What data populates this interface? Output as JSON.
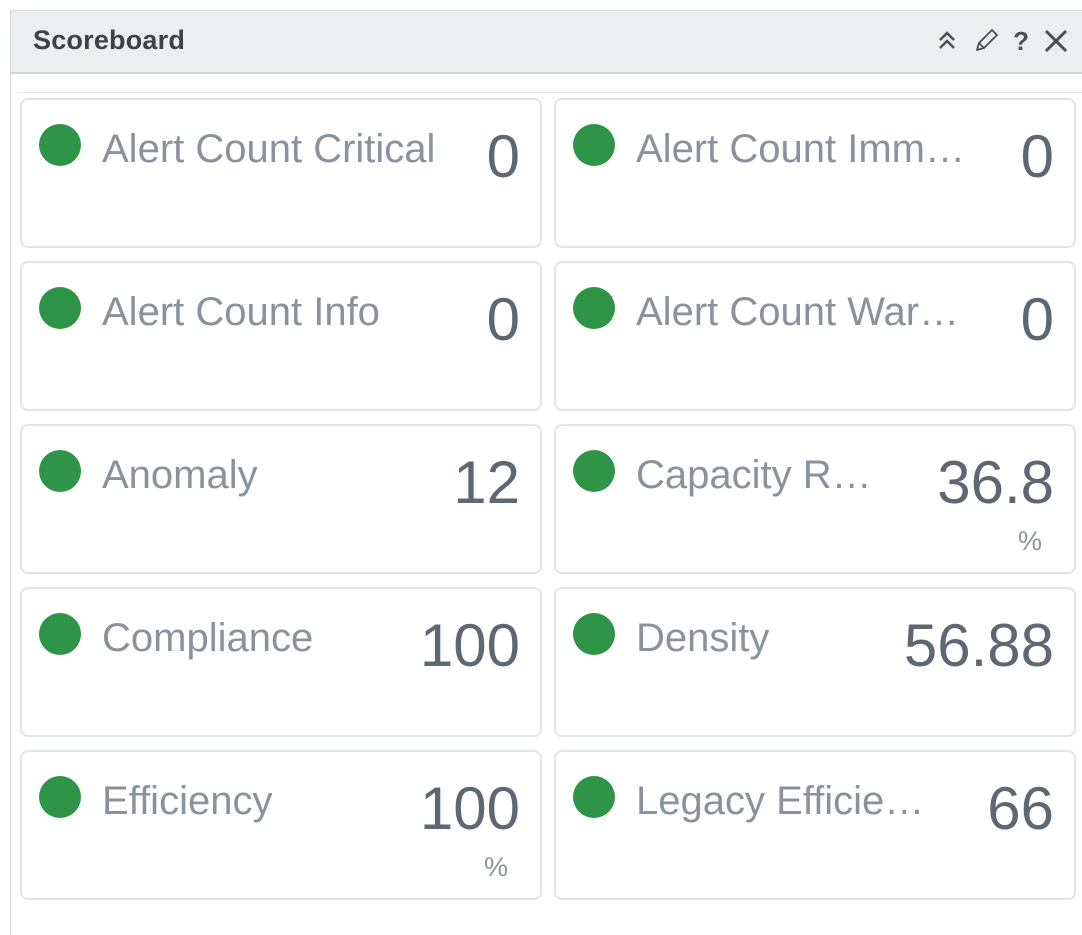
{
  "widget": {
    "title": "Scoreboard",
    "icons": [
      "collapse-icon",
      "edit-icon",
      "help-icon",
      "close-icon"
    ],
    "help_glyph": "?",
    "status_color": "#2e9447"
  },
  "tiles": [
    {
      "label": "Alert Count Critical",
      "value": "0",
      "unit": "",
      "status": "green"
    },
    {
      "label": "Alert Count Imm…",
      "value": "0",
      "unit": "",
      "status": "green"
    },
    {
      "label": "Alert Count Info",
      "value": "0",
      "unit": "",
      "status": "green"
    },
    {
      "label": "Alert Count War…",
      "value": "0",
      "unit": "",
      "status": "green"
    },
    {
      "label": "Anomaly",
      "value": "12",
      "unit": "",
      "status": "green"
    },
    {
      "label": "Capacity R…",
      "value": "36.8",
      "unit": "%",
      "status": "green"
    },
    {
      "label": "Compliance",
      "value": "100",
      "unit": "",
      "status": "green"
    },
    {
      "label": "Density",
      "value": "56.88",
      "unit": "",
      "status": "green"
    },
    {
      "label": "Efficiency",
      "value": "100",
      "unit": "%",
      "status": "green"
    },
    {
      "label": "Legacy Efficie…",
      "value": "66",
      "unit": "",
      "status": "green"
    }
  ]
}
